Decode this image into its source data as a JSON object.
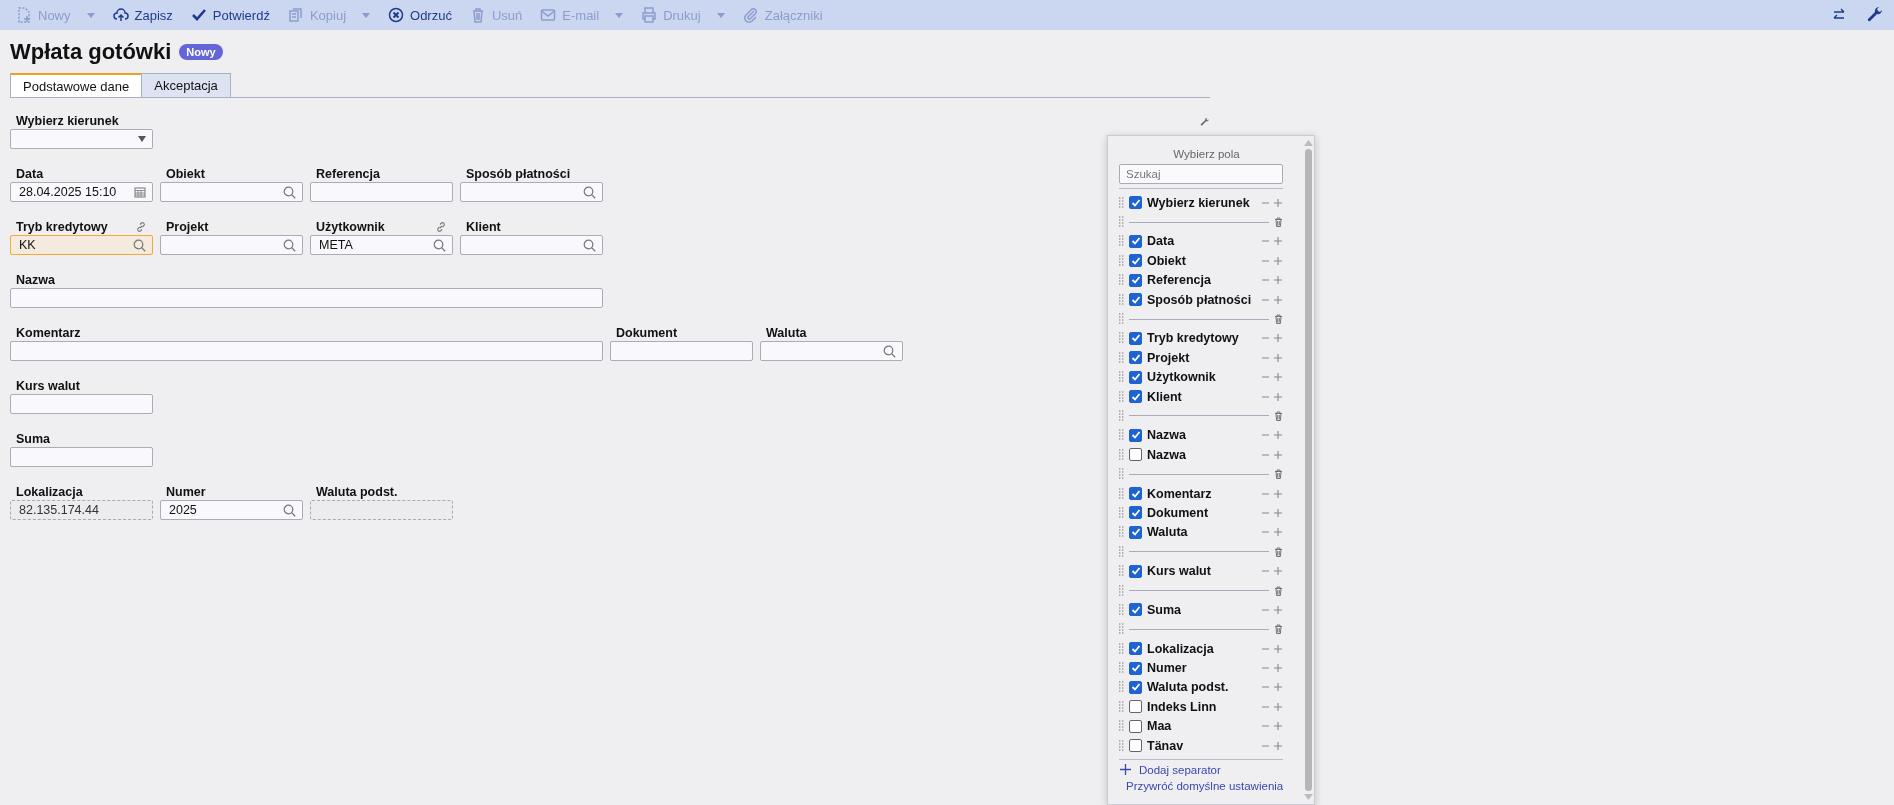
{
  "toolbar": {
    "buttons": [
      {
        "label": "Nowy",
        "disabled": true,
        "dropdown": true
      },
      {
        "label": "Zapisz",
        "disabled": false
      },
      {
        "label": "Potwierdź",
        "disabled": false
      },
      {
        "label": "Kopiuj",
        "disabled": true,
        "dropdown": true
      },
      {
        "label": "Odrzuć",
        "disabled": false
      },
      {
        "label": "Usuń",
        "disabled": true
      },
      {
        "label": "E-mail",
        "disabled": true,
        "dropdown": true
      },
      {
        "label": "Drukuj",
        "disabled": true,
        "dropdown": true
      },
      {
        "label": "Załączniki",
        "disabled": true
      }
    ]
  },
  "title": "Wpłata gotówki",
  "status_badge": "Nowy",
  "tabs": [
    {
      "label": "Podstawowe dane",
      "selected": true
    },
    {
      "label": "Akceptacja",
      "selected": false
    }
  ],
  "form_rows": [
    [
      {
        "label": "Wybierz kierunek",
        "kind": "select"
      }
    ],
    [
      {
        "label": "Data",
        "kind": "date",
        "value": "28.04.2025 15:10"
      },
      {
        "label": "Obiekt",
        "kind": "lookup"
      },
      {
        "label": "Referencja",
        "kind": "text"
      },
      {
        "label": "Sposób płatności",
        "kind": "lookup"
      }
    ],
    [
      {
        "label": "Tryb kredytowy",
        "kind": "lookup",
        "value": "KK",
        "linked": true,
        "highlighted": true
      },
      {
        "label": "Projekt",
        "kind": "lookup"
      },
      {
        "label": "Użytkownik",
        "kind": "lookup",
        "value": "META",
        "linked": true
      },
      {
        "label": "Klient",
        "kind": "lookup"
      }
    ],
    [
      {
        "label": "Nazwa",
        "kind": "text",
        "wide": true
      }
    ],
    [
      {
        "label": "Komentarz",
        "kind": "text",
        "wide": true
      },
      {
        "label": "Dokument",
        "kind": "text"
      },
      {
        "label": "Waluta",
        "kind": "lookup"
      }
    ],
    [
      {
        "label": "Kurs walut",
        "kind": "text"
      }
    ],
    [
      {
        "label": "Suma",
        "kind": "text"
      }
    ],
    [
      {
        "label": "Lokalizacja",
        "kind": "readonly",
        "value": "82.135.174.44"
      },
      {
        "label": "Numer",
        "kind": "lookup",
        "value": "2025"
      },
      {
        "label": "Waluta podst.",
        "kind": "readonly"
      }
    ]
  ],
  "field_picker": {
    "title": "Wybierz pola",
    "search": {
      "placeholder": "Szukaj"
    },
    "items": [
      {
        "kind": "field",
        "label": "Wybierz kierunek",
        "checked": true
      },
      {
        "kind": "separator"
      },
      {
        "kind": "field",
        "label": "Data",
        "checked": true
      },
      {
        "kind": "field",
        "label": "Obiekt",
        "checked": true
      },
      {
        "kind": "field",
        "label": "Referencja",
        "checked": true
      },
      {
        "kind": "field",
        "label": "Sposób płatności",
        "checked": true
      },
      {
        "kind": "separator"
      },
      {
        "kind": "field",
        "label": "Tryb kredytowy",
        "checked": true
      },
      {
        "kind": "field",
        "label": "Projekt",
        "checked": true
      },
      {
        "kind": "field",
        "label": "Użytkownik",
        "checked": true
      },
      {
        "kind": "field",
        "label": "Klient",
        "checked": true
      },
      {
        "kind": "separator"
      },
      {
        "kind": "field",
        "label": "Nazwa",
        "checked": true
      },
      {
        "kind": "field",
        "label": "Nazwa",
        "checked": false
      },
      {
        "kind": "separator"
      },
      {
        "kind": "field",
        "label": "Komentarz",
        "checked": true
      },
      {
        "kind": "field",
        "label": "Dokument",
        "checked": true
      },
      {
        "kind": "field",
        "label": "Waluta",
        "checked": true
      },
      {
        "kind": "separator"
      },
      {
        "kind": "field",
        "label": "Kurs walut",
        "checked": true
      },
      {
        "kind": "separator"
      },
      {
        "kind": "field",
        "label": "Suma",
        "checked": true
      },
      {
        "kind": "separator"
      },
      {
        "kind": "field",
        "label": "Lokalizacja",
        "checked": true
      },
      {
        "kind": "field",
        "label": "Numer",
        "checked": true
      },
      {
        "kind": "field",
        "label": "Waluta podst.",
        "checked": true
      },
      {
        "kind": "field",
        "label": "Indeks Linn",
        "checked": false
      },
      {
        "kind": "field",
        "label": "Maa",
        "checked": false
      },
      {
        "kind": "field",
        "label": "Tänav",
        "checked": false
      }
    ],
    "actions": [
      "Dodaj separator",
      "Przywróć domyślne ustawienia"
    ]
  }
}
